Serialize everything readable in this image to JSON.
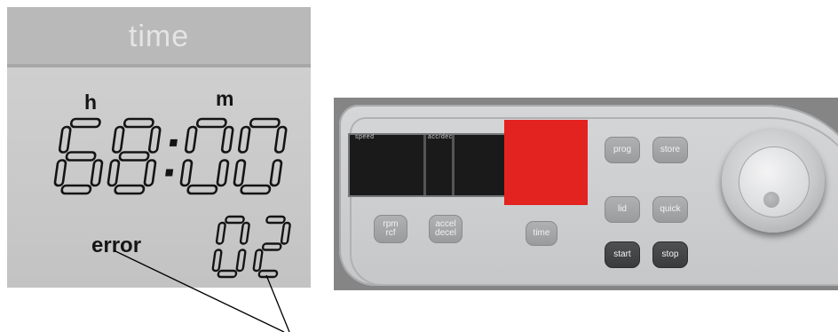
{
  "lcd": {
    "title": "time",
    "unit_hours": "h",
    "unit_minutes": "m",
    "time_value": "68:00",
    "error_label": "error",
    "error_code": "02"
  },
  "panel": {
    "display_labels": {
      "speed": "speed",
      "accel": "acc/dec"
    },
    "buttons": {
      "rpm_rcf": [
        "rpm",
        "rcf"
      ],
      "accel_decel": [
        "accel",
        "decel"
      ],
      "time": "time",
      "prog": "prog",
      "store": "store",
      "lid": "lid",
      "quick": "quick",
      "start": "start",
      "stop": "stop"
    }
  },
  "colors": {
    "highlight": "#e3231f",
    "lcd_background": "#c8c8c8",
    "lcd_segment": "#141414",
    "panel_face": "#cecfd1",
    "dark_button": "#444546"
  },
  "icons": {
    "knob": "rotary-knob-icon"
  }
}
